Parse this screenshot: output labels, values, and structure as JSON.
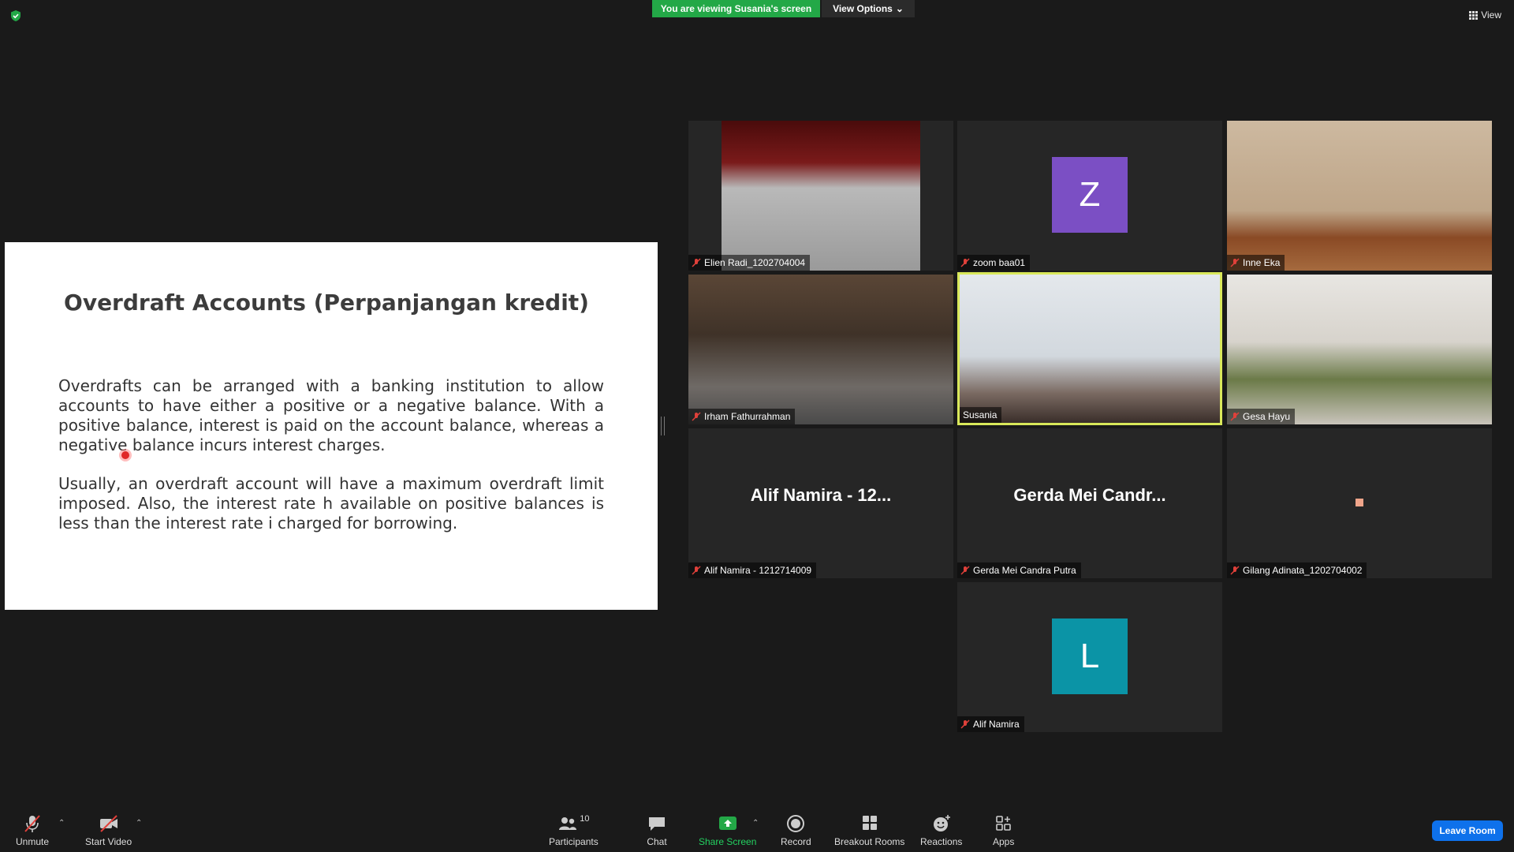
{
  "top_bar": {
    "banner": "You are viewing Susania's screen",
    "view_options": "View Options",
    "view": "View"
  },
  "slide": {
    "title": "Overdraft Accounts (Perpanjangan kredit)",
    "para1": "Overdrafts can be arranged with a banking institution to allow accounts to have either a positive or a negative balance. With a positive balance, interest is paid on the account balance, whereas a negative balance incurs interest charges.",
    "para2": "Usually, an overdraft account will have a maximum overdraft limit imposed. Also, the interest rate h available on positive balances is less than the interest rate i charged for borrowing."
  },
  "participants": [
    {
      "label": "Elien Radi_1202704004"
    },
    {
      "label": "zoom baa01",
      "avatar": "Z",
      "avatar_color": "#7b4fc4"
    },
    {
      "label": "Inne Eka"
    },
    {
      "label": "Irham Fathurrahman"
    },
    {
      "label": "Susania",
      "active": true
    },
    {
      "label": "Gesa Hayu"
    },
    {
      "label": "Alif Namira - 1212714009",
      "center": "Alif Namira - 12..."
    },
    {
      "label": "Gerda Mei Candra Putra",
      "center": "Gerda Mei Candr..."
    },
    {
      "label": "Gilang Adinata_1202704002"
    },
    {
      "label": "Alif Namira",
      "avatar": "L",
      "avatar_color": "#0b94a6"
    }
  ],
  "toolbar": {
    "unmute": "Unmute",
    "start_video": "Start Video",
    "participants": "Participants",
    "participants_count": "10",
    "chat": "Chat",
    "share_screen": "Share Screen",
    "record": "Record",
    "breakout_rooms": "Breakout Rooms",
    "reactions": "Reactions",
    "apps": "Apps",
    "leave": "Leave Room"
  },
  "colors": {
    "banner_green": "#23a847",
    "share_green": "#23a847",
    "leave_blue": "#0e71eb",
    "active_border": "#d9e85a",
    "muted_red": "#e0403a"
  }
}
